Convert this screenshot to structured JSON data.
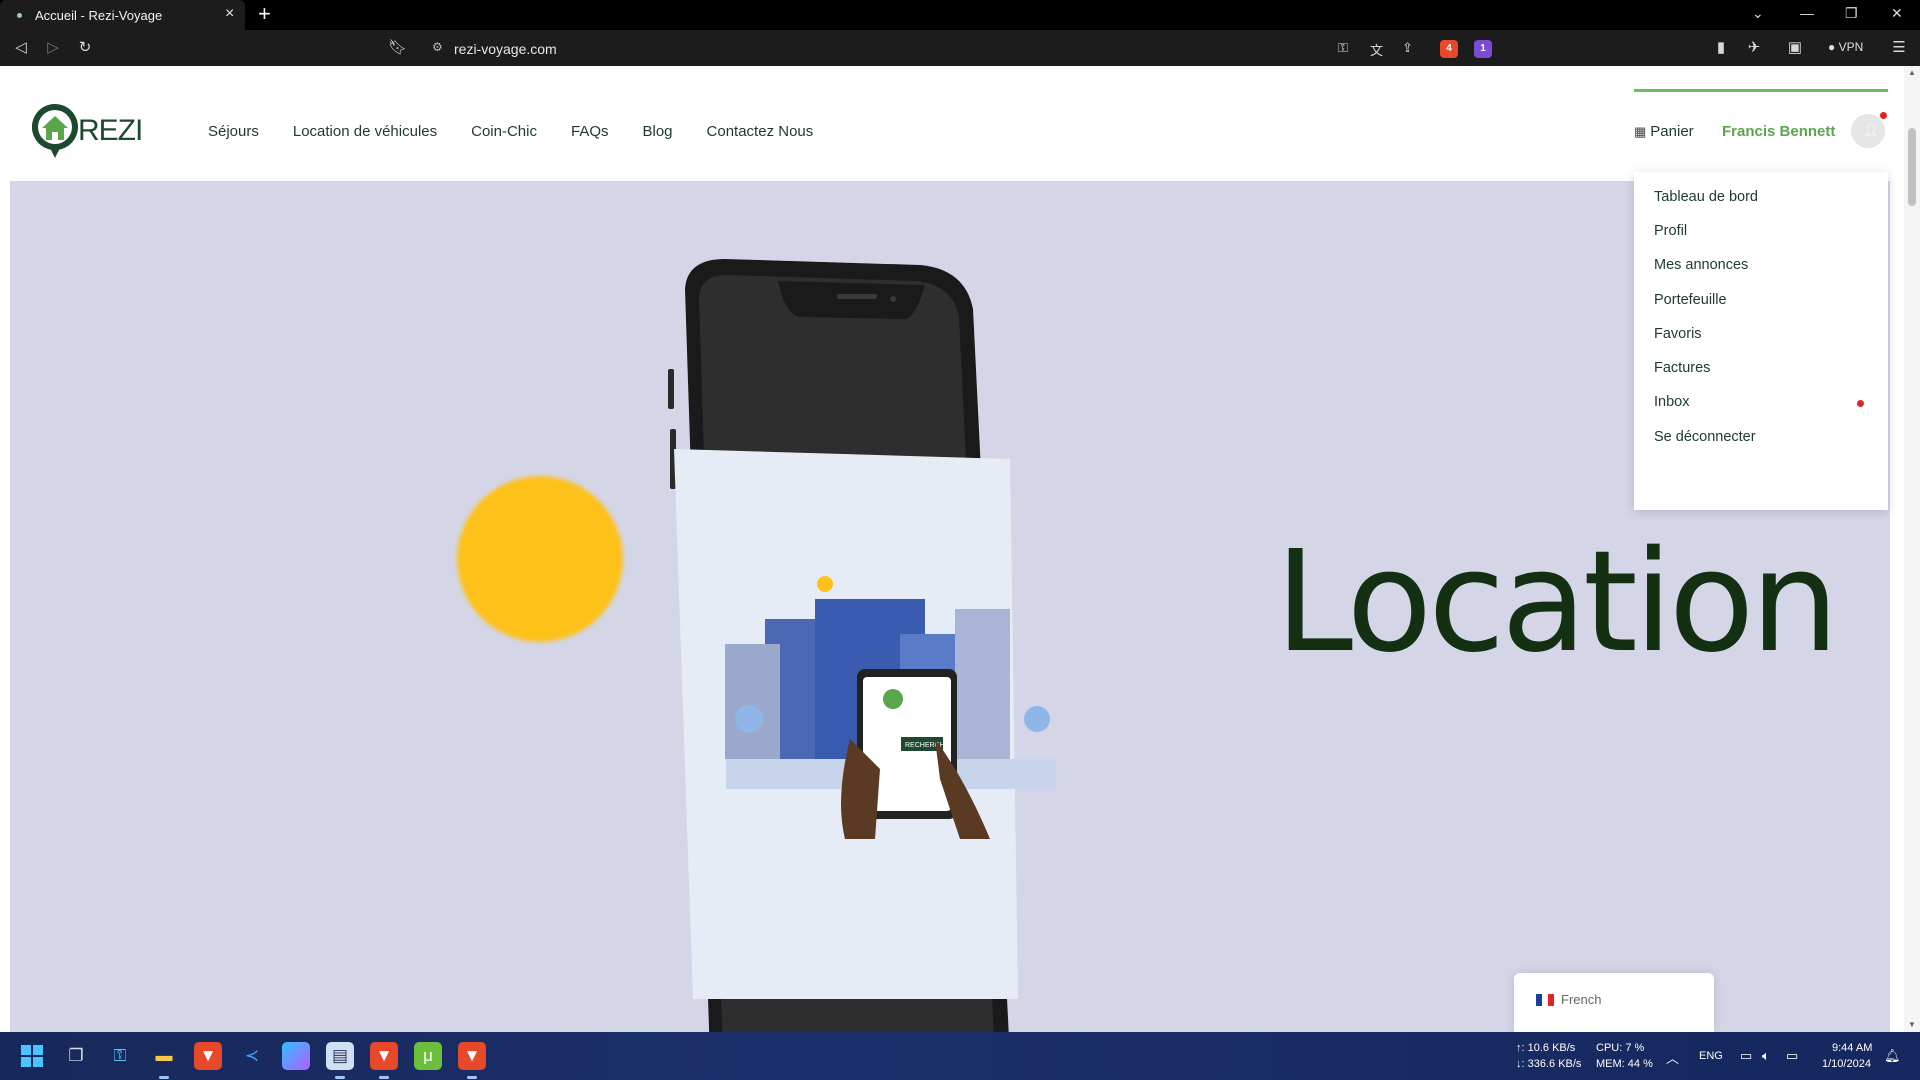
{
  "browser": {
    "tab_title": "Accueil - Rezi-Voyage",
    "url": "rezi-voyage.com",
    "vpn_label": "VPN",
    "shield_badge": "4",
    "alert_badge": "1"
  },
  "site": {
    "logo_text": "REZI",
    "nav": [
      "Séjours",
      "Location de véhicules",
      "Coin-Chic",
      "FAQs",
      "Blog",
      "Contactez Nous"
    ],
    "cart_label": "Panier",
    "user_name": "Francis Bennett"
  },
  "user_menu": {
    "items": [
      "Tableau de bord",
      "Profil",
      "Mes annonces",
      "Portefeuille",
      "Favoris",
      "Factures",
      "Inbox",
      "Se déconnecter"
    ],
    "inbox_has_notification": true
  },
  "hero": {
    "word": "Location",
    "phone_button_text": "RECHERCHE"
  },
  "language_widget": {
    "label": "French"
  },
  "taskbar": {
    "upload": "↑: 10.6 KB/s",
    "download": "↓: 336.6 KB/s",
    "cpu": "CPU: 7 %",
    "mem": "MEM: 44 %",
    "lang": "ENG",
    "time": "9:44 AM",
    "date": "1/10/2024"
  },
  "colors": {
    "brand_green": "#5aa64a",
    "hero_bg": "#d4d6e8",
    "sun": "#fdc11a",
    "dark_text": "#1e3a2a"
  }
}
